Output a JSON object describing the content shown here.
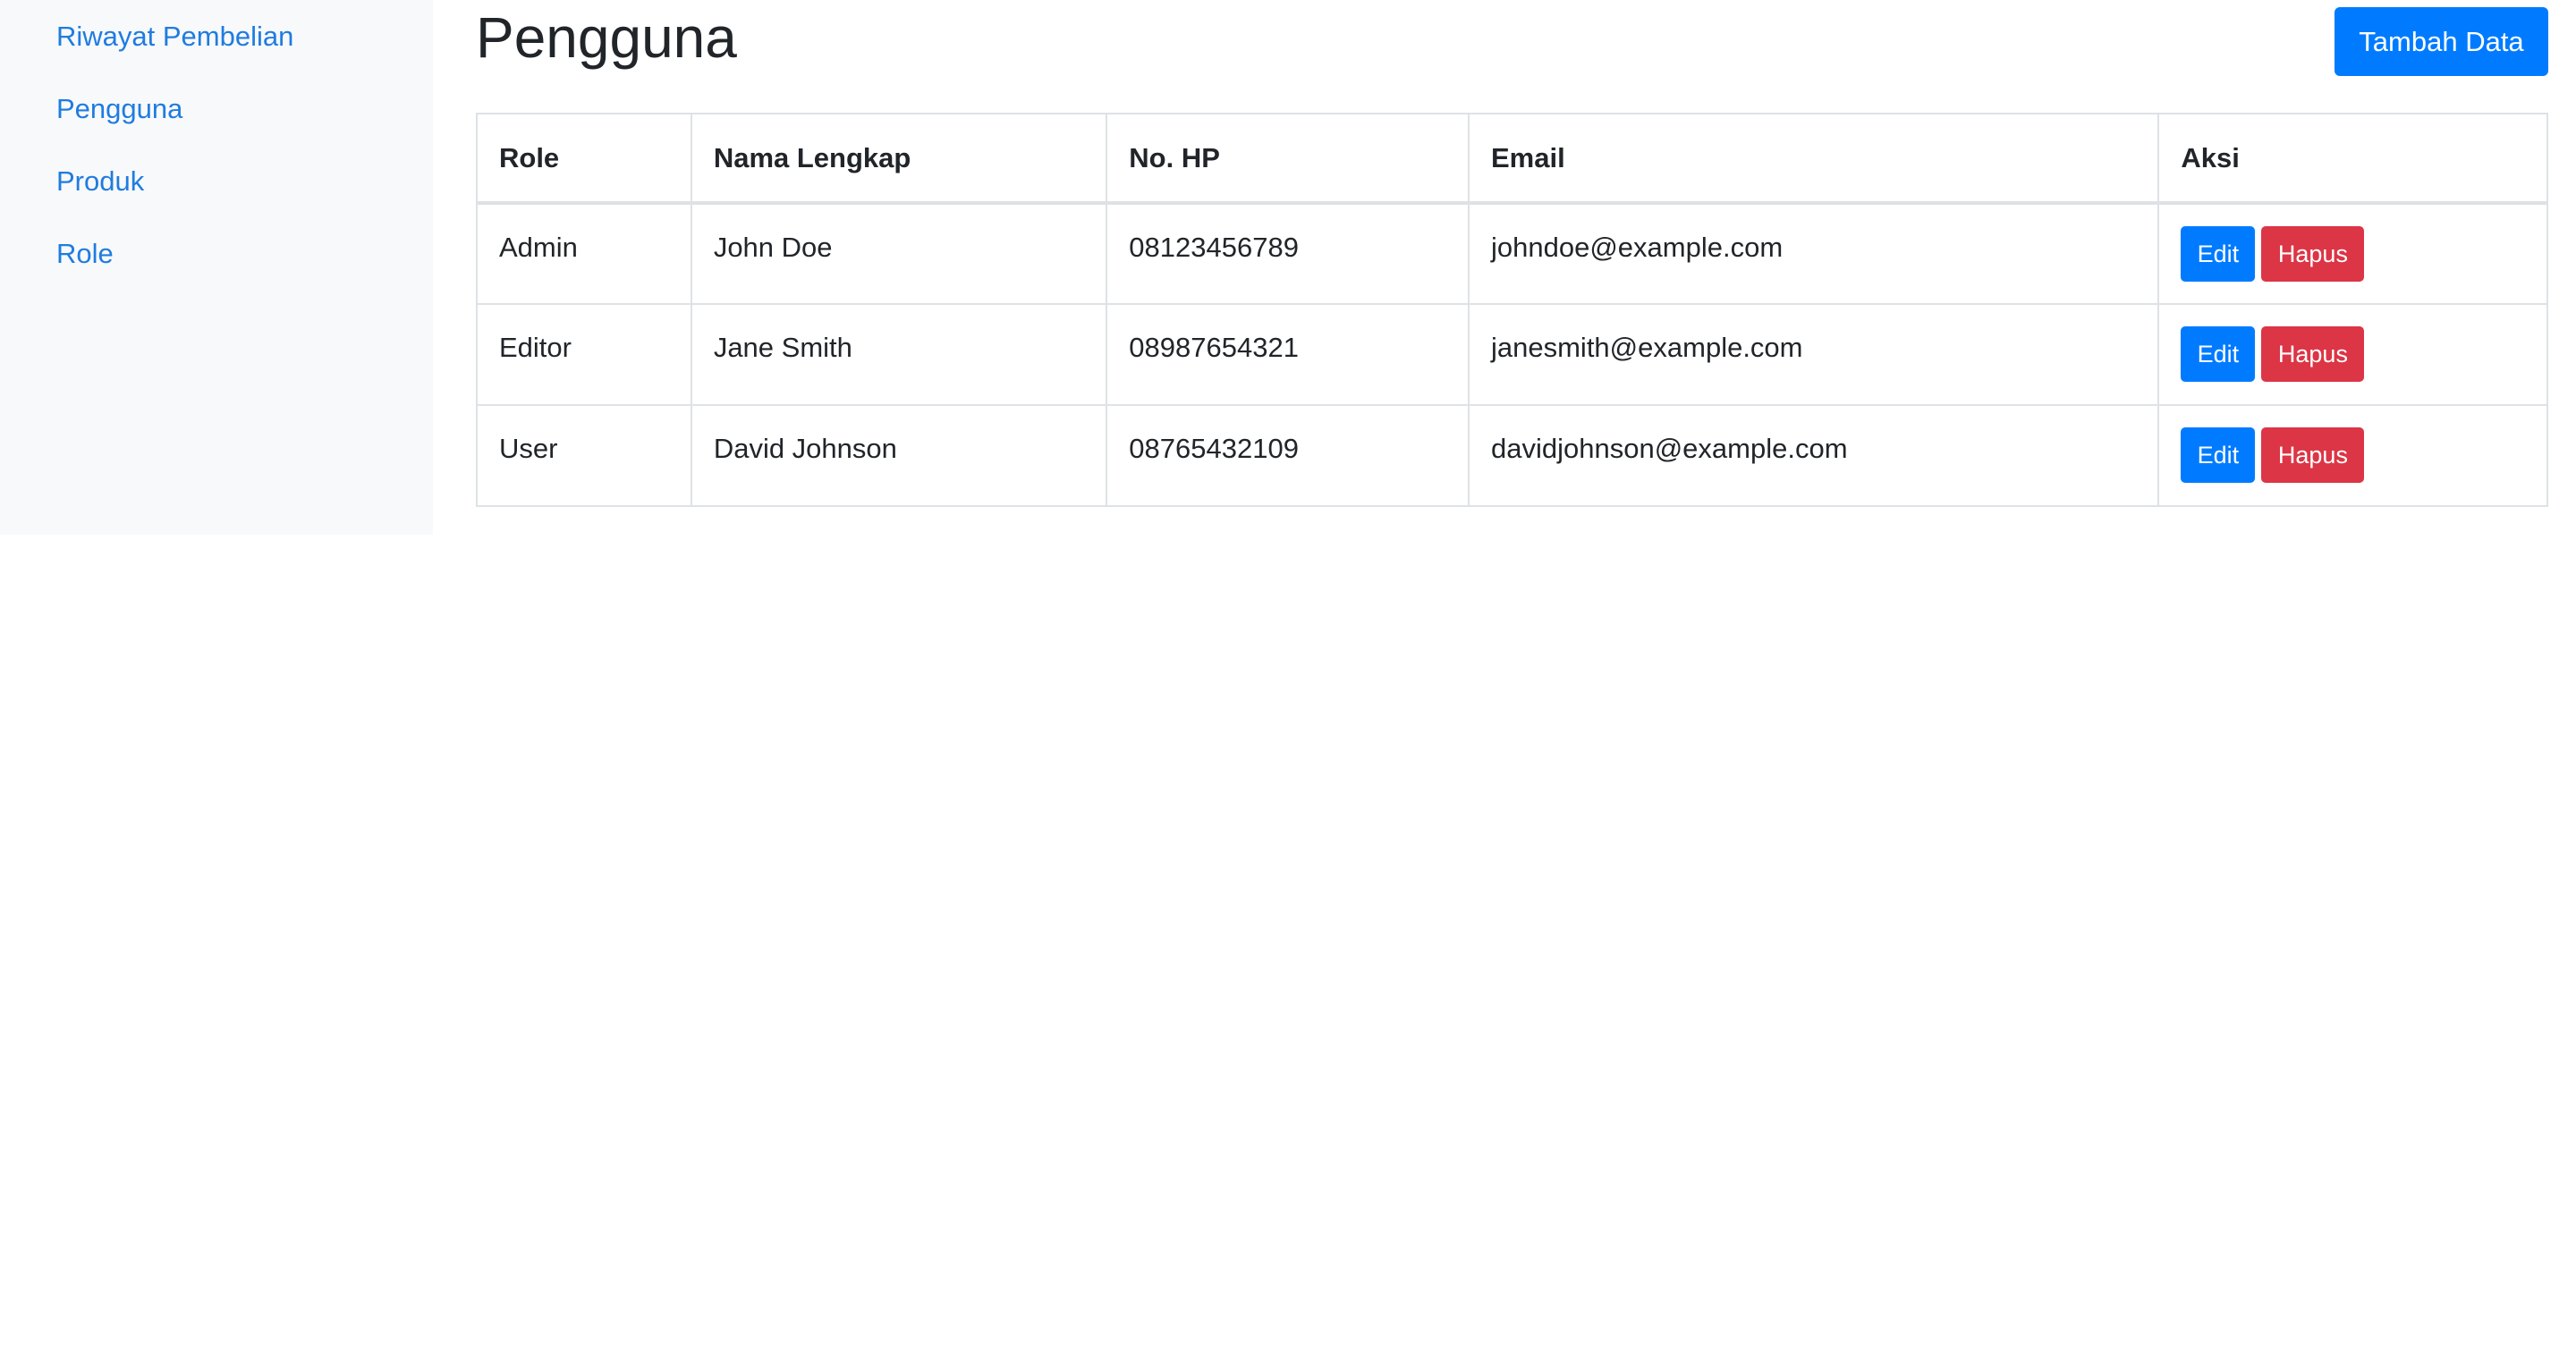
{
  "sidebar": {
    "items": [
      {
        "label": "Riwayat Pembelian"
      },
      {
        "label": "Pengguna"
      },
      {
        "label": "Produk"
      },
      {
        "label": "Role"
      }
    ]
  },
  "main": {
    "title": "Pengguna",
    "add_button_label": "Tambah Data",
    "table": {
      "headers": [
        "Role",
        "Nama Lengkap",
        "No. HP",
        "Email",
        "Aksi"
      ],
      "rows": [
        {
          "role": "Admin",
          "name": "John Doe",
          "phone": "08123456789",
          "email": "johndoe@example.com",
          "edit": "Edit",
          "delete": "Hapus"
        },
        {
          "role": "Editor",
          "name": "Jane Smith",
          "phone": "08987654321",
          "email": "janesmith@example.com",
          "edit": "Edit",
          "delete": "Hapus"
        },
        {
          "role": "User",
          "name": "David Johnson",
          "phone": "08765432109",
          "email": "davidjohnson@example.com",
          "edit": "Edit",
          "delete": "Hapus"
        }
      ]
    }
  },
  "colors": {
    "primary": "#007bff",
    "danger": "#dc3545",
    "link": "#1f7ce0",
    "sidebar_bg": "#f8f9fa"
  }
}
